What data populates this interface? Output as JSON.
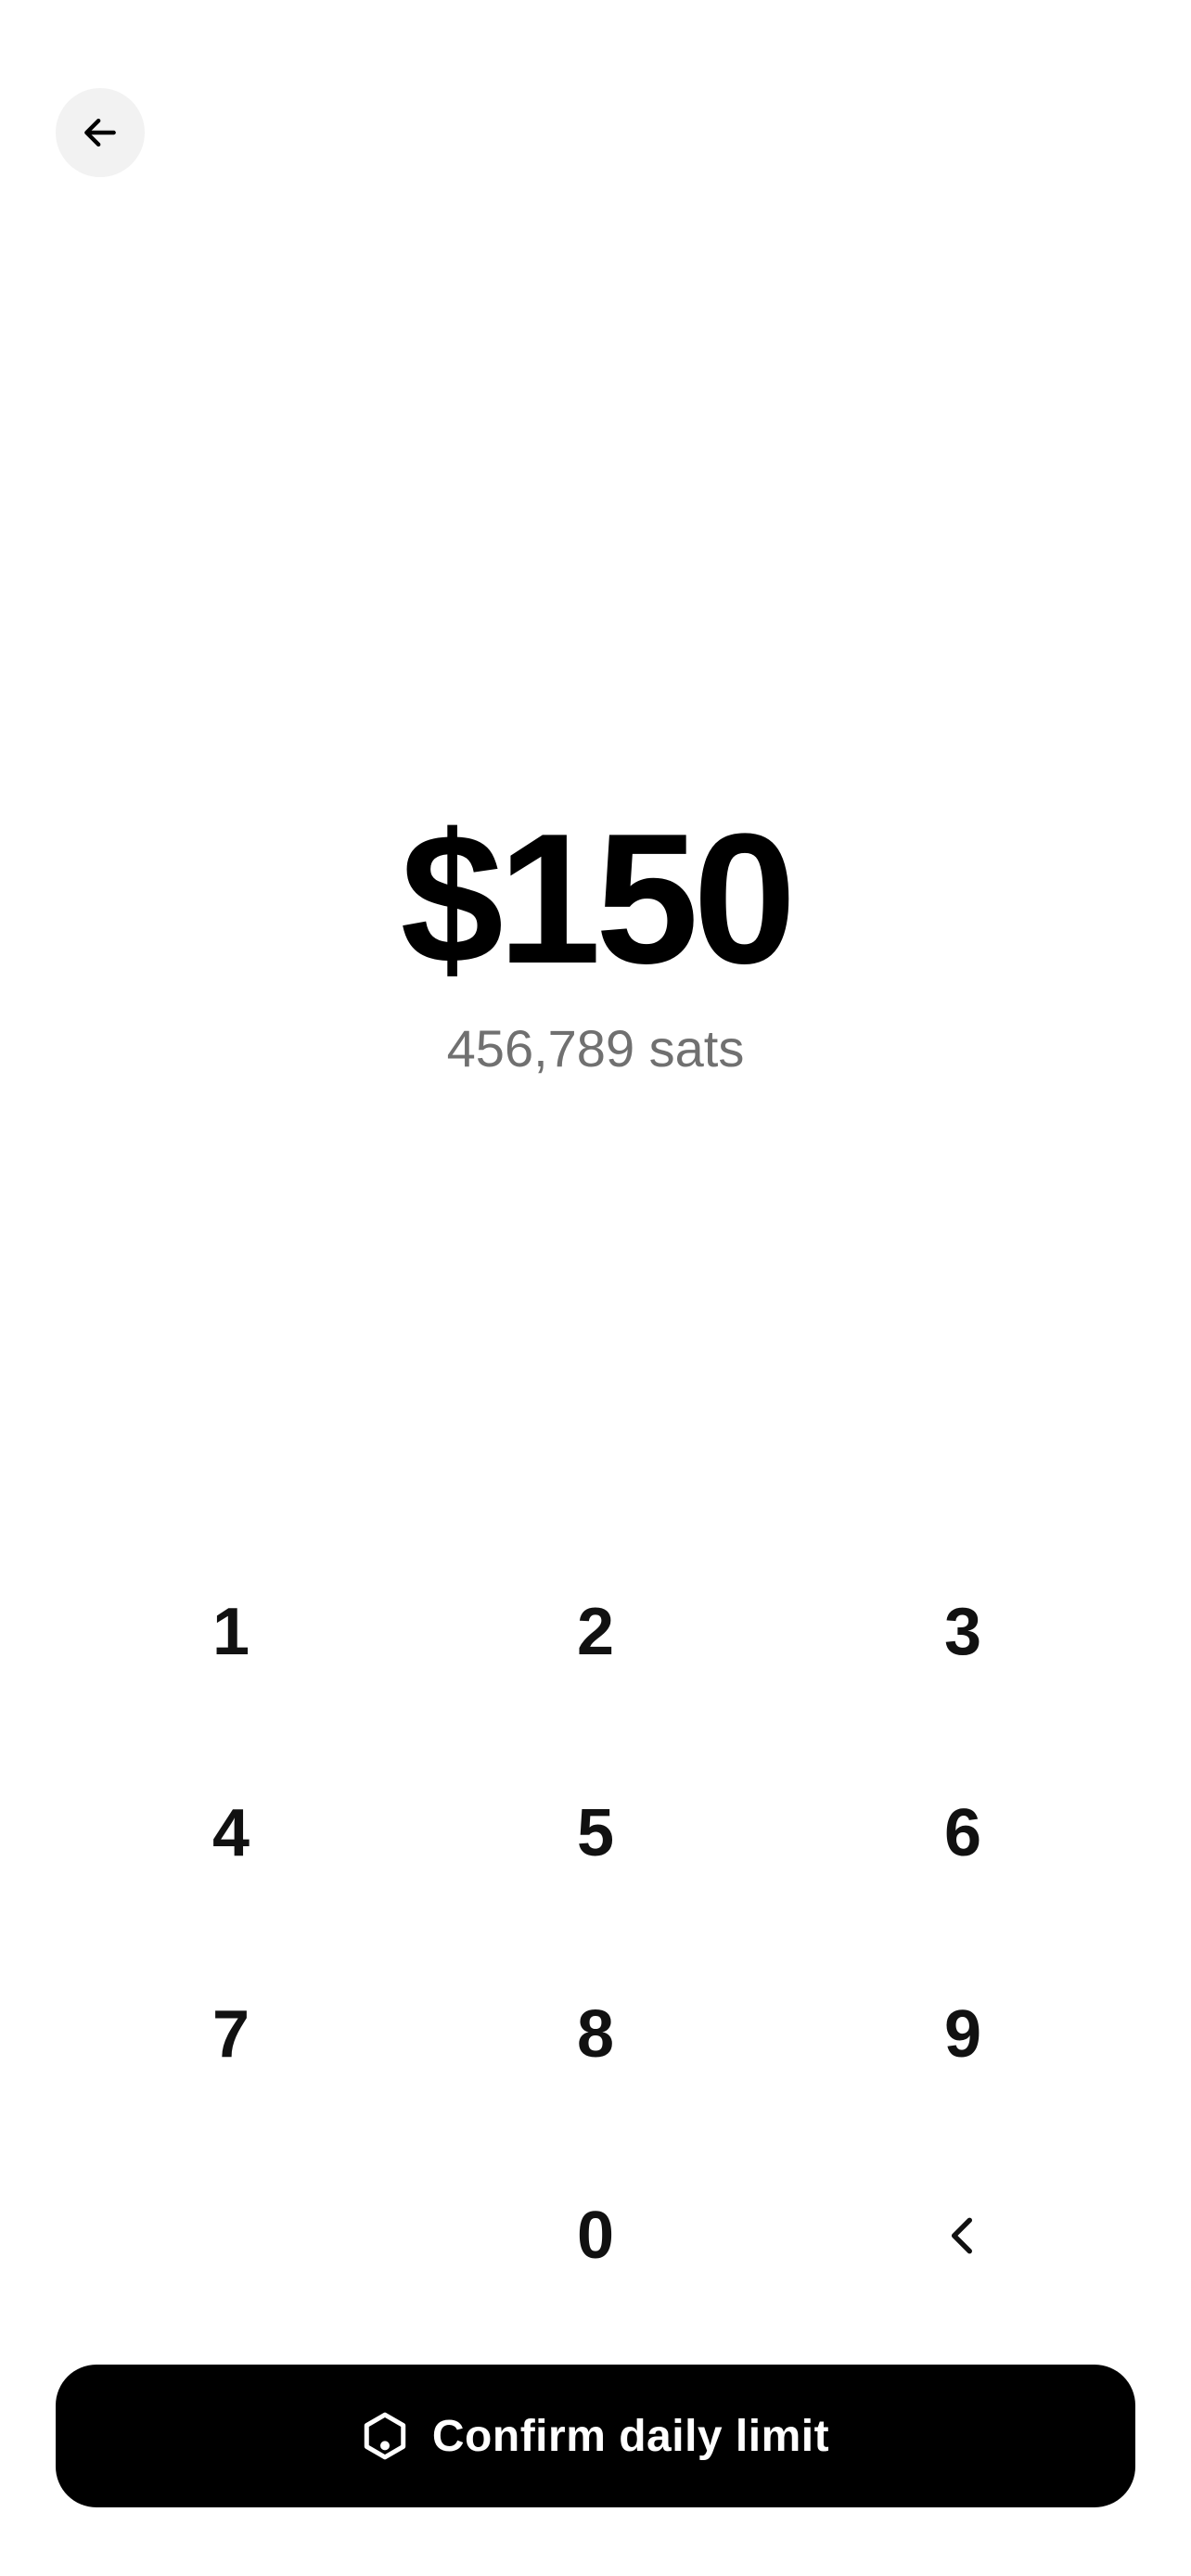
{
  "colors": {
    "background": "#ffffff",
    "text_primary": "#000000",
    "text_secondary": "#707070",
    "back_button_bg": "#f2f2f2",
    "confirm_button_bg": "#000000",
    "confirm_button_text": "#ffffff"
  },
  "header": {
    "back_icon": "arrow-left-icon"
  },
  "amount": {
    "fiat": "$150",
    "sats": "456,789 sats"
  },
  "keypad": {
    "keys": [
      "1",
      "2",
      "3",
      "4",
      "5",
      "6",
      "7",
      "8",
      "9",
      "0"
    ],
    "backspace_icon": "chevron-left-icon"
  },
  "confirm": {
    "icon": "hexagon-icon",
    "label": "Confirm daily limit"
  }
}
